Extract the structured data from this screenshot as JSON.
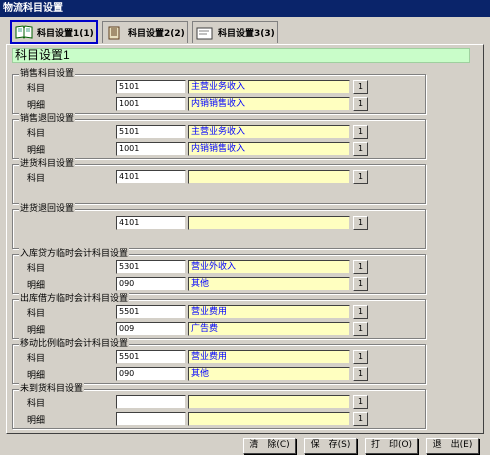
{
  "window": {
    "title": "物流科目设置"
  },
  "tabs": [
    {
      "label": "科目设置1(1)",
      "icon": "book-icon",
      "active": true
    },
    {
      "label": "科目设置2(2)",
      "icon": "ledger-icon",
      "active": false
    },
    {
      "label": "科目设置3(3)",
      "icon": "document-icon",
      "active": false
    }
  ],
  "panel": {
    "heading": "科目设置1"
  },
  "groups": [
    {
      "title": "销售科目设置",
      "rows": [
        {
          "label": "科目",
          "code": "5101",
          "name": "主营业务收入"
        },
        {
          "label": "明细",
          "code": "1001",
          "name": "内销销售收入"
        }
      ]
    },
    {
      "title": "销售退回设置",
      "rows": [
        {
          "label": "科目",
          "code": "5101",
          "name": "主营业务收入"
        },
        {
          "label": "明细",
          "code": "1001",
          "name": "内销销售收入"
        }
      ]
    },
    {
      "title": "进货科目设置",
      "rows": [
        {
          "label": "科目",
          "code": "4101",
          "name": ""
        }
      ]
    },
    {
      "title": "进货退回设置",
      "rows": [
        {
          "label": "",
          "code": "4101",
          "name": ""
        }
      ]
    },
    {
      "title": "入库贷方临时会计科目设置",
      "rows": [
        {
          "label": "科目",
          "code": "5301",
          "name": "营业外收入"
        },
        {
          "label": "明细",
          "code": "090",
          "name": "其他"
        }
      ]
    },
    {
      "title": "出库借方临时会计科目设置",
      "rows": [
        {
          "label": "科目",
          "code": "5501",
          "name": "营业费用"
        },
        {
          "label": "明细",
          "code": "009",
          "name": "广告费"
        }
      ]
    },
    {
      "title": "移动比例临时会计科目设置",
      "rows": [
        {
          "label": "科目",
          "code": "5501",
          "name": "营业费用"
        },
        {
          "label": "明细",
          "code": "090",
          "name": "其他"
        }
      ]
    },
    {
      "title": "未到货科目设置",
      "rows": [
        {
          "label": "科目",
          "code": "",
          "name": ""
        },
        {
          "label": "明细",
          "code": "",
          "name": ""
        }
      ]
    }
  ],
  "pick_button_label": "1",
  "buttons": {
    "clear": "清　除(C)",
    "save": "保　存(S)",
    "print": "打　印(O)",
    "exit": "退　出(E)"
  },
  "colors": {
    "title_bar": "#0a246a",
    "heading_bg": "#c9fdc9",
    "name_field_bg": "#ffffc0",
    "name_text": "#0000ff",
    "active_tab_border": "#0000c8"
  }
}
